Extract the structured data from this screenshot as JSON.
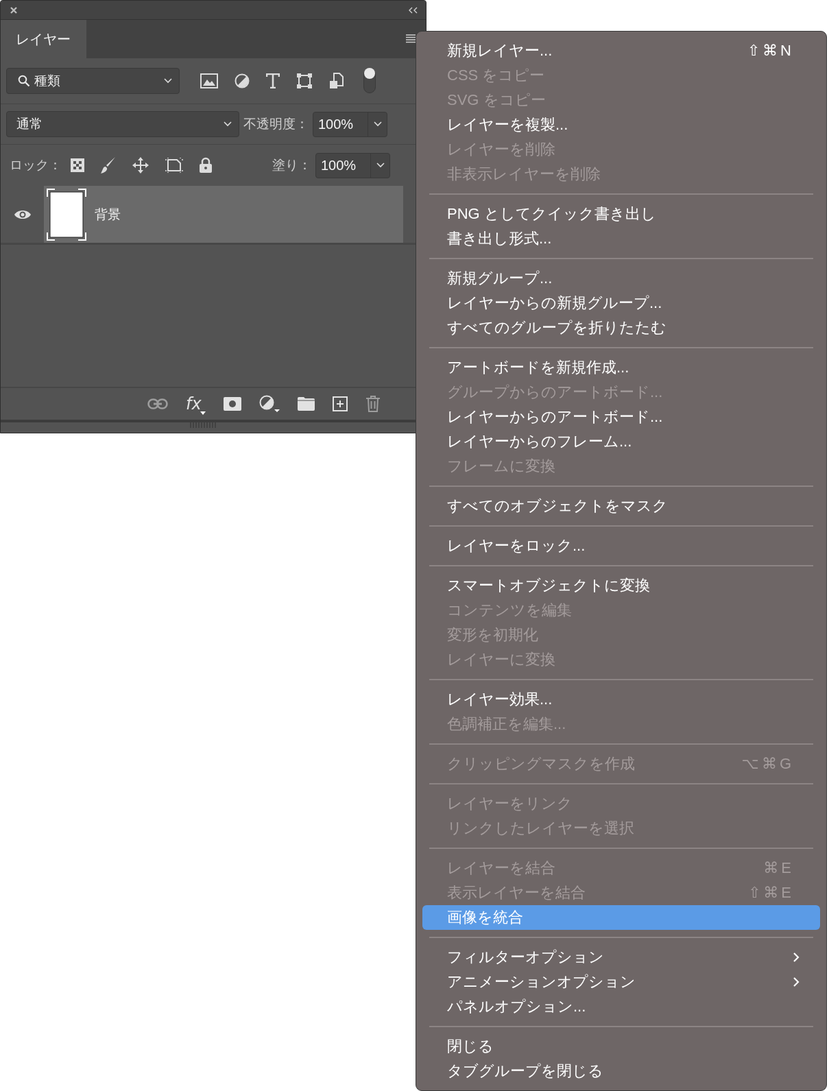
{
  "panel": {
    "tabs": [
      {
        "label": "レイヤー",
        "selected": true
      }
    ],
    "filter": {
      "value": "種類",
      "toggle_on": true
    },
    "blend": {
      "value": "通常"
    },
    "opacity": {
      "label": "不透明度：",
      "value": "100%"
    },
    "lock": {
      "label": "ロック："
    },
    "fill": {
      "label": "塗り：",
      "value": "100%"
    },
    "layers": [
      {
        "name": "背景",
        "visible": true,
        "selected": true
      }
    ],
    "footer": [
      {
        "kind": "link",
        "disabled": true
      },
      {
        "kind": "fx",
        "label": "fx",
        "disabled": false
      },
      {
        "kind": "mask",
        "disabled": false
      },
      {
        "kind": "adjustment",
        "disabled": false
      },
      {
        "kind": "group",
        "disabled": false
      },
      {
        "kind": "new",
        "disabled": false
      },
      {
        "kind": "delete",
        "disabled": true
      }
    ]
  },
  "menu": {
    "sections": [
      {
        "items": [
          {
            "label": "新規レイヤー...",
            "shortcut": "⇧⌘N",
            "disabled": false,
            "selected": false,
            "submenu": false
          },
          {
            "label": "CSS をコピー",
            "disabled": true,
            "selected": false,
            "submenu": false
          },
          {
            "label": "SVG をコピー",
            "disabled": true,
            "selected": false,
            "submenu": false
          },
          {
            "label": "レイヤーを複製...",
            "disabled": false,
            "selected": false,
            "submenu": false
          },
          {
            "label": "レイヤーを削除",
            "disabled": true,
            "selected": false,
            "submenu": false
          },
          {
            "label": "非表示レイヤーを削除",
            "disabled": true,
            "selected": false,
            "submenu": false
          }
        ]
      },
      {
        "items": [
          {
            "label": "PNG としてクイック書き出し",
            "disabled": false,
            "selected": false,
            "submenu": false
          },
          {
            "label": "書き出し形式...",
            "disabled": false,
            "selected": false,
            "submenu": false
          }
        ]
      },
      {
        "items": [
          {
            "label": "新規グループ...",
            "disabled": false,
            "selected": false,
            "submenu": false
          },
          {
            "label": "レイヤーからの新規グループ...",
            "disabled": false,
            "selected": false,
            "submenu": false
          },
          {
            "label": "すべてのグループを折りたたむ",
            "disabled": false,
            "selected": false,
            "submenu": false
          }
        ]
      },
      {
        "items": [
          {
            "label": "アートボードを新規作成...",
            "disabled": false,
            "selected": false,
            "submenu": false
          },
          {
            "label": "グループからのアートボード...",
            "disabled": true,
            "selected": false,
            "submenu": false
          },
          {
            "label": "レイヤーからのアートボード...",
            "disabled": false,
            "selected": false,
            "submenu": false
          },
          {
            "label": "レイヤーからのフレーム...",
            "disabled": false,
            "selected": false,
            "submenu": false
          },
          {
            "label": "フレームに変換",
            "disabled": true,
            "selected": false,
            "submenu": false
          }
        ]
      },
      {
        "items": [
          {
            "label": "すべてのオブジェクトをマスク",
            "disabled": false,
            "selected": false,
            "submenu": false
          }
        ]
      },
      {
        "items": [
          {
            "label": "レイヤーをロック...",
            "disabled": false,
            "selected": false,
            "submenu": false
          }
        ]
      },
      {
        "items": [
          {
            "label": "スマートオブジェクトに変換",
            "disabled": false,
            "selected": false,
            "submenu": false
          },
          {
            "label": "コンテンツを編集",
            "disabled": true,
            "selected": false,
            "submenu": false
          },
          {
            "label": "変形を初期化",
            "disabled": true,
            "selected": false,
            "submenu": false
          },
          {
            "label": "レイヤーに変換",
            "disabled": true,
            "selected": false,
            "submenu": false
          }
        ]
      },
      {
        "items": [
          {
            "label": "レイヤー効果...",
            "disabled": false,
            "selected": false,
            "submenu": false
          },
          {
            "label": "色調補正を編集...",
            "disabled": true,
            "selected": false,
            "submenu": false
          }
        ]
      },
      {
        "items": [
          {
            "label": "クリッピングマスクを作成",
            "shortcut": "⌥⌘G",
            "disabled": true,
            "selected": false,
            "submenu": false
          }
        ]
      },
      {
        "items": [
          {
            "label": "レイヤーをリンク",
            "disabled": true,
            "selected": false,
            "submenu": false
          },
          {
            "label": "リンクしたレイヤーを選択",
            "disabled": true,
            "selected": false,
            "submenu": false
          }
        ]
      },
      {
        "items": [
          {
            "label": "レイヤーを結合",
            "shortcut": "⌘E",
            "disabled": true,
            "selected": false,
            "submenu": false
          },
          {
            "label": "表示レイヤーを結合",
            "shortcut": "⇧⌘E",
            "disabled": true,
            "selected": false,
            "submenu": false
          },
          {
            "label": "画像を統合",
            "disabled": false,
            "selected": true,
            "submenu": false
          }
        ]
      },
      {
        "items": [
          {
            "label": "フィルターオプション",
            "disabled": false,
            "selected": false,
            "submenu": true
          },
          {
            "label": "アニメーションオプション",
            "disabled": false,
            "selected": false,
            "submenu": true
          },
          {
            "label": "パネルオプション...",
            "disabled": false,
            "selected": false,
            "submenu": false
          }
        ]
      },
      {
        "items": [
          {
            "label": "閉じる",
            "disabled": false,
            "selected": false,
            "submenu": false
          },
          {
            "label": "タブグループを閉じる",
            "disabled": false,
            "selected": false,
            "submenu": false
          }
        ]
      }
    ]
  }
}
